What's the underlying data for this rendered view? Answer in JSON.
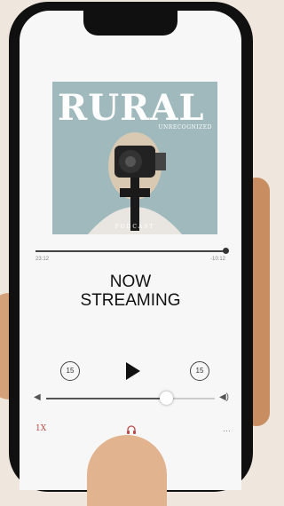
{
  "cover": {
    "title": "RURAL",
    "subtitle": "UNRECOGNIZED",
    "tag": "PODCAST"
  },
  "progress": {
    "elapsed": "23:12",
    "remaining": "-10:12",
    "fraction": 1.0
  },
  "now_playing": {
    "line1": "NOW",
    "line2": "STREAMING"
  },
  "controls": {
    "skip_back": "15",
    "skip_forward": "15"
  },
  "volume": {
    "level": 0.71
  },
  "bottom": {
    "speed_label": "1X",
    "more_label": "…"
  },
  "colors": {
    "accent": "#b84a4a",
    "cover_bg": "#9fb9bd"
  }
}
